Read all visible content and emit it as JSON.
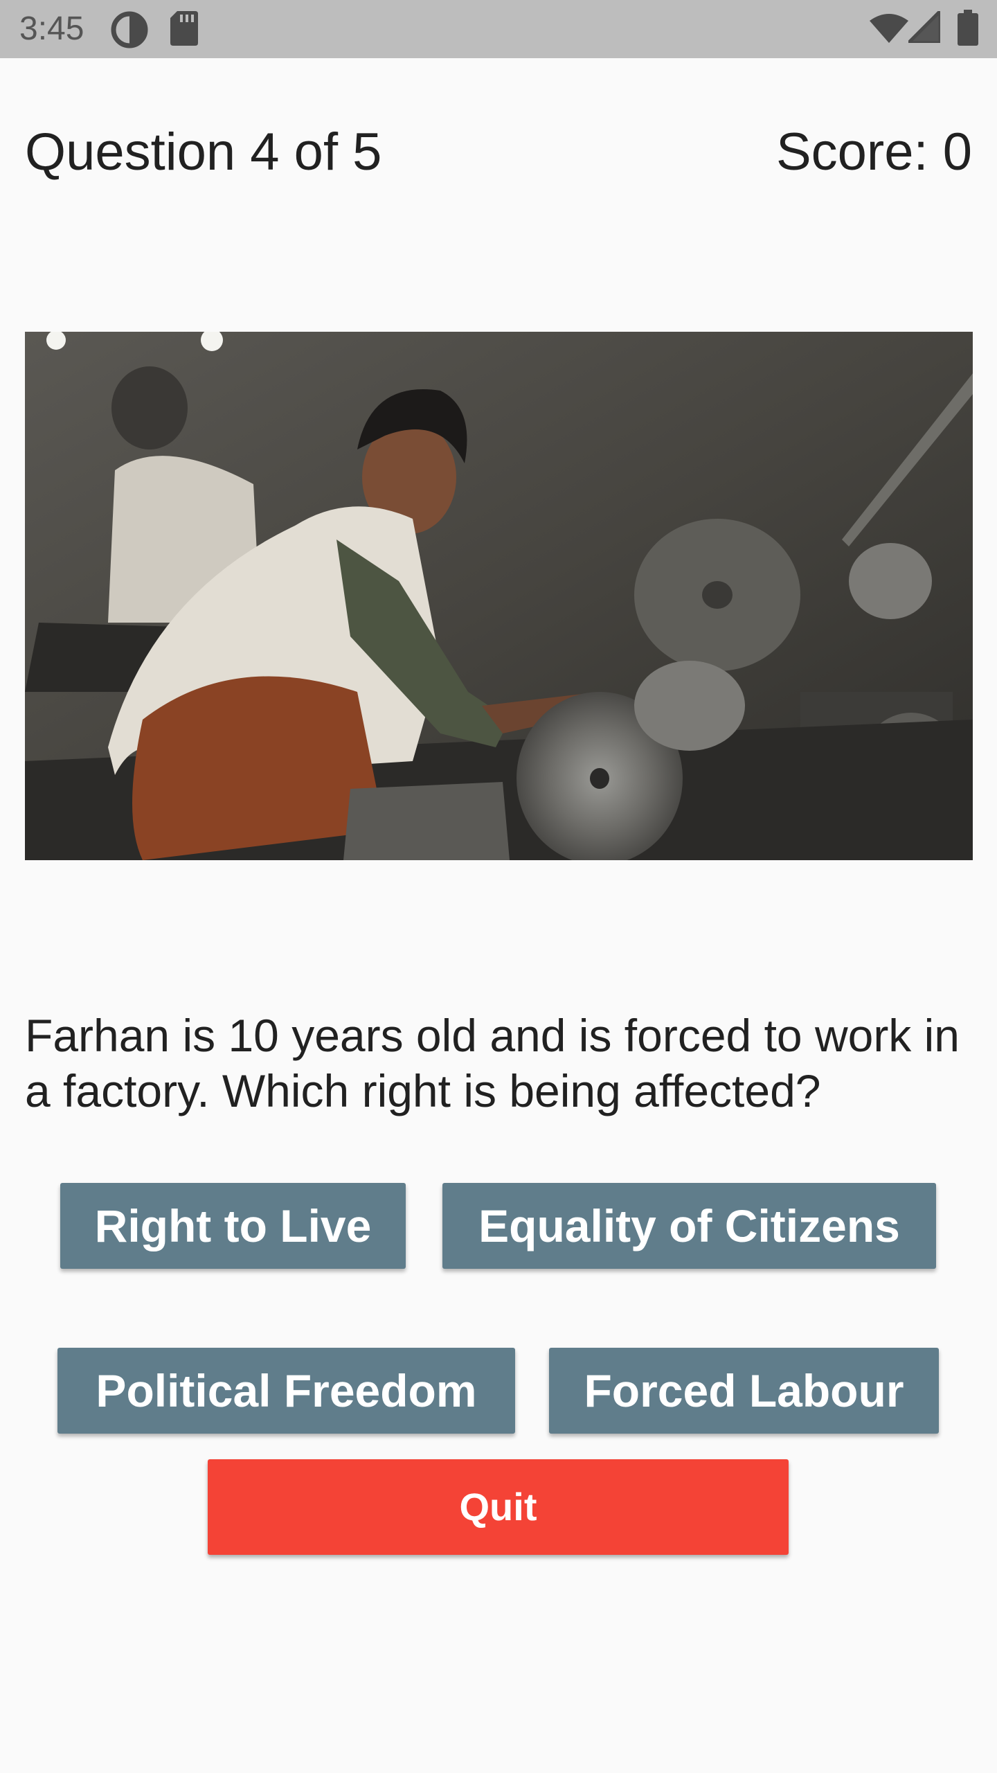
{
  "status_bar": {
    "time": "3:45",
    "color": "#bdbdbd"
  },
  "quiz": {
    "question_counter": "Question 4 of 5",
    "score": "Score: 0",
    "question_text": "Farhan is 10 years old and is forced to work in a factory. Which right is being affected?",
    "answers": [
      "Right to Live",
      "Equality of Citizens",
      "Political Freedom",
      "Forced Labour"
    ],
    "quit_label": "Quit"
  },
  "colors": {
    "background": "#fafafa",
    "answer_button": "#607d8b",
    "quit_button": "#f44336",
    "text": "#212121"
  },
  "icons": {
    "status_left": [
      "data-saver-icon",
      "sd-card-icon"
    ],
    "status_right": [
      "wifi-icon",
      "cellular-signal-icon",
      "battery-icon"
    ]
  }
}
